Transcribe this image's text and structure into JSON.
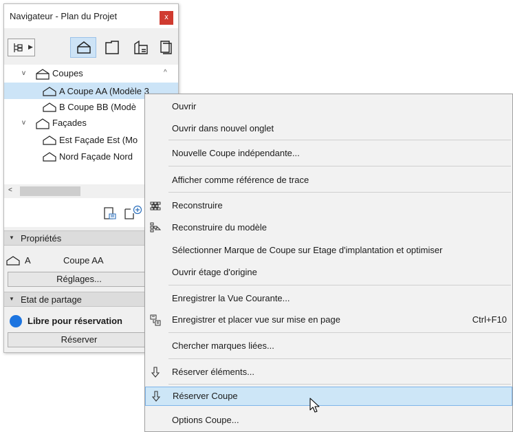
{
  "navigator": {
    "title": "Navigateur - Plan du Projet",
    "close_glyph": "x",
    "toolbar": {
      "map_button_icon": "project-map-icon",
      "views": [
        "floor-plan-icon",
        "section-icon",
        "elevation-icon",
        "layout-book-icon"
      ],
      "active_view": "section-icon"
    },
    "tree": [
      {
        "label": "Coupes",
        "level": 0,
        "expanded": true
      },
      {
        "label": "A Coupe AA (Modèle 3",
        "level": 1,
        "selected": true
      },
      {
        "label": "B Coupe BB (Modè",
        "level": 1
      },
      {
        "label": "Façades",
        "level": 0,
        "expanded": true
      },
      {
        "label": "Est Façade Est (Mo",
        "level": 1
      },
      {
        "label": "Nord Façade Nord",
        "level": 1
      }
    ],
    "properties": {
      "header": "Propriétés",
      "id": "A",
      "name": "Coupe AA",
      "settings_button": "Réglages..."
    },
    "sharing": {
      "header": "Etat de partage",
      "status": "Libre pour réservation",
      "status_color": "#1c74e0",
      "reserve_button": "Réserver"
    }
  },
  "context_menu": {
    "items": [
      {
        "label": "Ouvrir"
      },
      {
        "label": "Ouvrir dans nouvel onglet",
        "separator_after": true
      },
      {
        "label": "Nouvelle Coupe indépendante...",
        "separator_after": true
      },
      {
        "label": "Afficher comme référence de trace",
        "separator_after": true
      },
      {
        "label": "Reconstruire",
        "icon": "rebuild-icon"
      },
      {
        "label": "Reconstruire du modèle",
        "icon": "rebuild-from-model-icon"
      },
      {
        "label": "Sélectionner Marque de Coupe sur Etage d'implantation et optimiser"
      },
      {
        "label": "Ouvrir étage d'origine",
        "separator_after": true
      },
      {
        "label": "Enregistrer la Vue Courante..."
      },
      {
        "label": "Enregistrer et placer vue sur mise en page",
        "icon": "save-place-view-icon",
        "shortcut": "Ctrl+F10",
        "separator_after": true
      },
      {
        "label": "Chercher marques liées...",
        "separator_after": true
      },
      {
        "label": "Réserver éléments...",
        "icon": "reserve-arrow-icon",
        "separator_after": true
      },
      {
        "label": "Réserver Coupe",
        "icon": "reserve-arrow-icon",
        "highlighted": true
      },
      {
        "label": "Options Coupe..."
      }
    ],
    "highlight_color": "#cde6f7"
  }
}
